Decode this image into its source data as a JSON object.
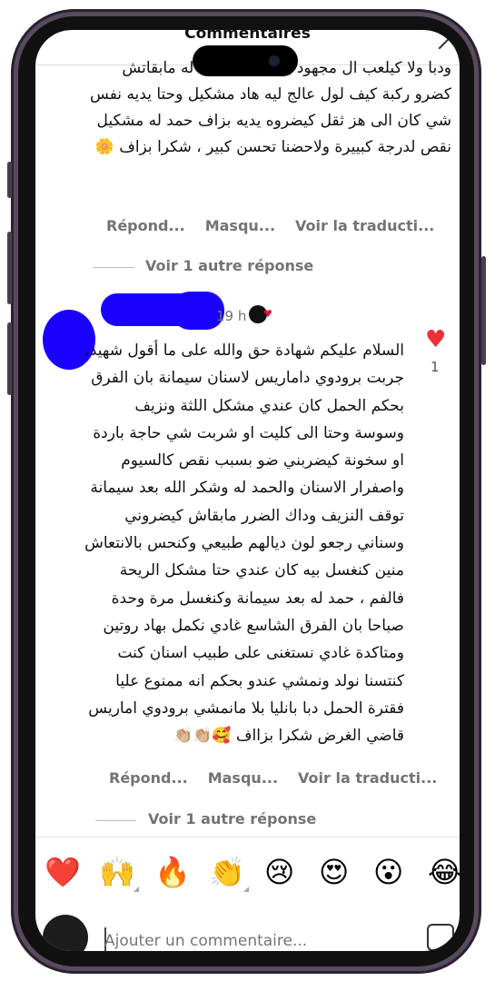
{
  "header": {
    "title": "Commentaires"
  },
  "comment1": {
    "text": "ودبا ولا كيلعب ال مجهود بيت كبير وحمد له مابقاتش كضرو ركبة كيف لول عالج ليه هاد مشكيل وحتا يديه نفس شي كان الى هز ثقل كيضروه يديه بزاف حمد له مشكيل نقص لدرجة كبييرة ولاحضنا تحسن كبير ، شكرا بزاف 🌼",
    "actions": [
      "Répond...",
      "Masqu...",
      "Voir la traducti..."
    ],
    "more_replies": "Voir 1 autre réponse"
  },
  "comment2": {
    "time": "19 h",
    "text": "السلام عليكم شهادة حق والله على ما أقول شهيد، جربت برودوي داماريس لاسنان سيمانة بان الفرق بحكم الحمل كان عندي مشكل اللثة ونزيف وسوسة وحتا الى كليت او شربت شي حاجة باردة او سخونة كيضربني ضو بسبب نقص كالسيوم واصفرار الاسنان والحمد له وشكر الله بعد سيمانة توقف النزيف وداك الضرر مابقاش كيضروني وسناني رجعو لون ديالهم طبيعي وكنحس بالانتعاش منين كنغسل بيه كان عندي حتا مشكل الريحة فالفم ، حمد له بعد سيمانة وكنغسل مرة وحدة صباحا بان الفرق الشاسع غادي نكمل بهاد روتين ومتاكدة غادي نستغنى على طبيب اسنان كنت كنتسنا نولد ونمشي عندو بحكم انه ممنوع عليا فقترة الحمل دبا بانليا بلا مانمشي برودوي اماريس قاضي الغرض شكرا بزااف 🥰👏🏼👏🏼",
    "like_count": "1",
    "actions": [
      "Répond...",
      "Masqu...",
      "Voir la traducti..."
    ],
    "more_replies": "Voir 1 autre réponse"
  },
  "emoji_bar": [
    "❤️",
    "🙌",
    "🔥",
    "👏",
    "😢",
    "😍",
    "😮",
    "😂"
  ],
  "composer": {
    "placeholder": "Ajouter un commentaire..."
  }
}
